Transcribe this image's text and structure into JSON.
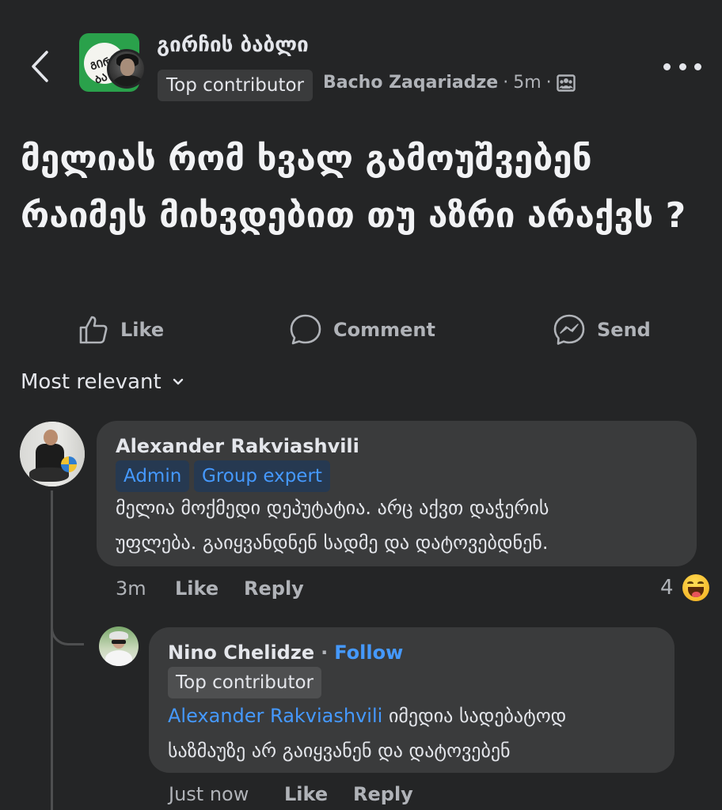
{
  "header": {
    "group_name": "გირჩის ბაბლი",
    "group_avatar_text": "ᲒᲘᲠᲩ ᲑᲐ",
    "author_badge": "Top contributor",
    "author": "Bacho Zaqariadze",
    "separator": "·",
    "time": "5m",
    "separator2": "·",
    "audience_icon": "group-audience-icon"
  },
  "post": {
    "text": "მელიას რომ ხვალ გამოუშვებენ რაიმეს მიხვდებით თუ აზრი არაქვს ?"
  },
  "actions": {
    "like": "Like",
    "comment": "Comment",
    "send": "Send"
  },
  "sort": {
    "label": "Most relevant"
  },
  "comments": [
    {
      "name": "Alexander Rakviashvili",
      "badges": [
        "Admin",
        "Group expert"
      ],
      "text_line1": "მელია მოქმედი დეპუტატია. არც აქვთ დაჭერის",
      "text_line2": "უფლება. გაიყვანდნენ სადმე და დატოვებდნენ.",
      "time": "3m",
      "like": "Like",
      "reply": "Reply",
      "reactions_count": "4",
      "reaction_icon": "laughing-emoji-icon",
      "replies": [
        {
          "name": "Nino Chelidze",
          "separator": "·",
          "follow": "Follow",
          "badge": "Top contributor",
          "mention": "Alexander Rakviashvili",
          "text_line1": " იმედია სადებატოდ",
          "text_line2": "საზმაუზე არ გაიყვანენ და დატოვებენ",
          "time": "Just now",
          "like": "Like",
          "reply": "Reply"
        }
      ]
    }
  ],
  "colors": {
    "background": "#242526",
    "bubble": "#3a3b3c",
    "accent": "#4599ff",
    "secondary_text": "#b0b3b8"
  }
}
